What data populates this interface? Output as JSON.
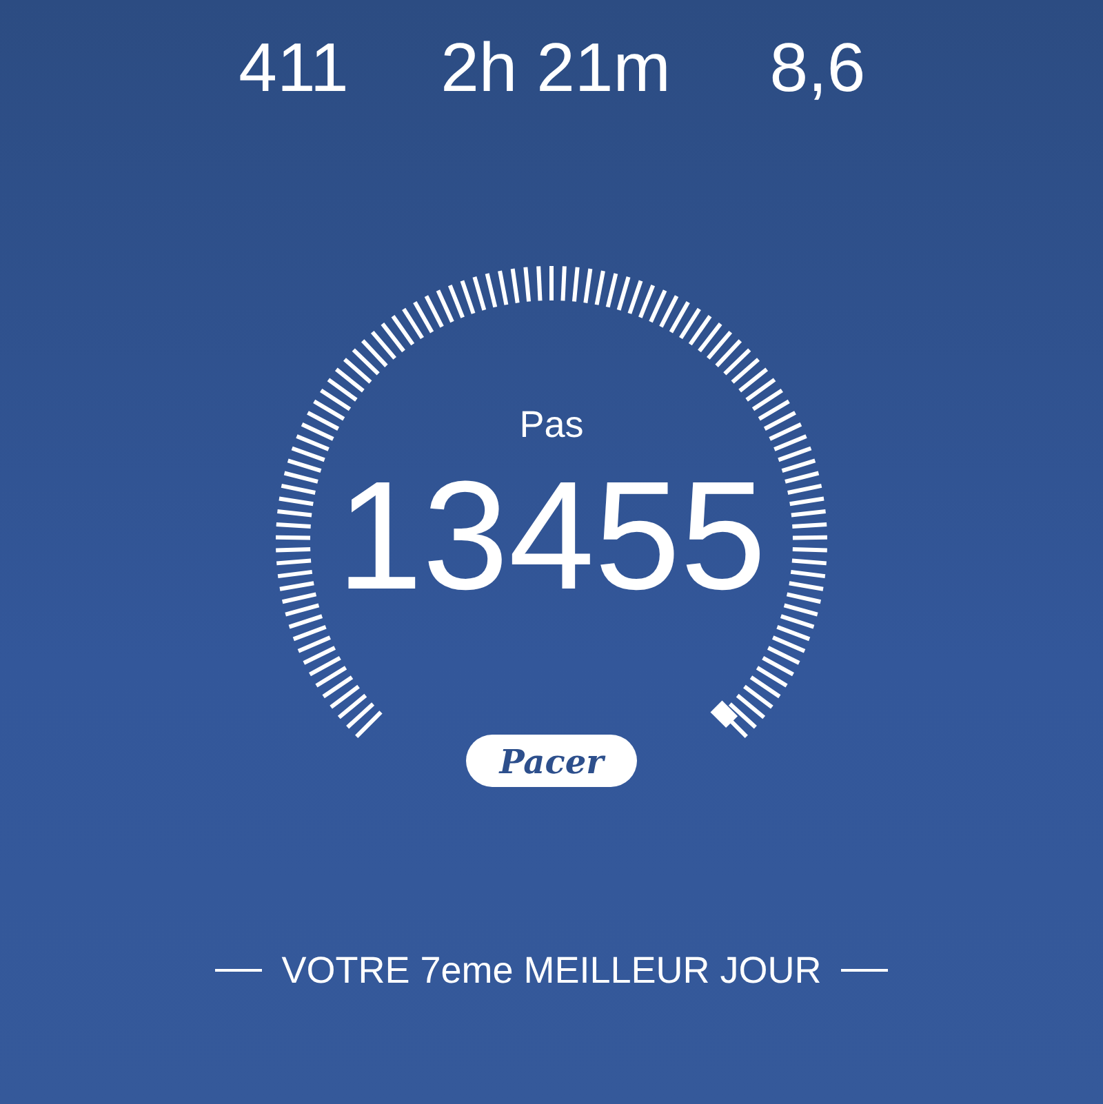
{
  "stats": [
    {
      "value": "411"
    },
    {
      "value": "2h 21m"
    },
    {
      "value": "8,6"
    }
  ],
  "gauge": {
    "label": "Pas",
    "value": "13455",
    "logo": "Pacer"
  },
  "footer": {
    "text": "VOTRE 7eme MEILLEUR JOUR"
  }
}
